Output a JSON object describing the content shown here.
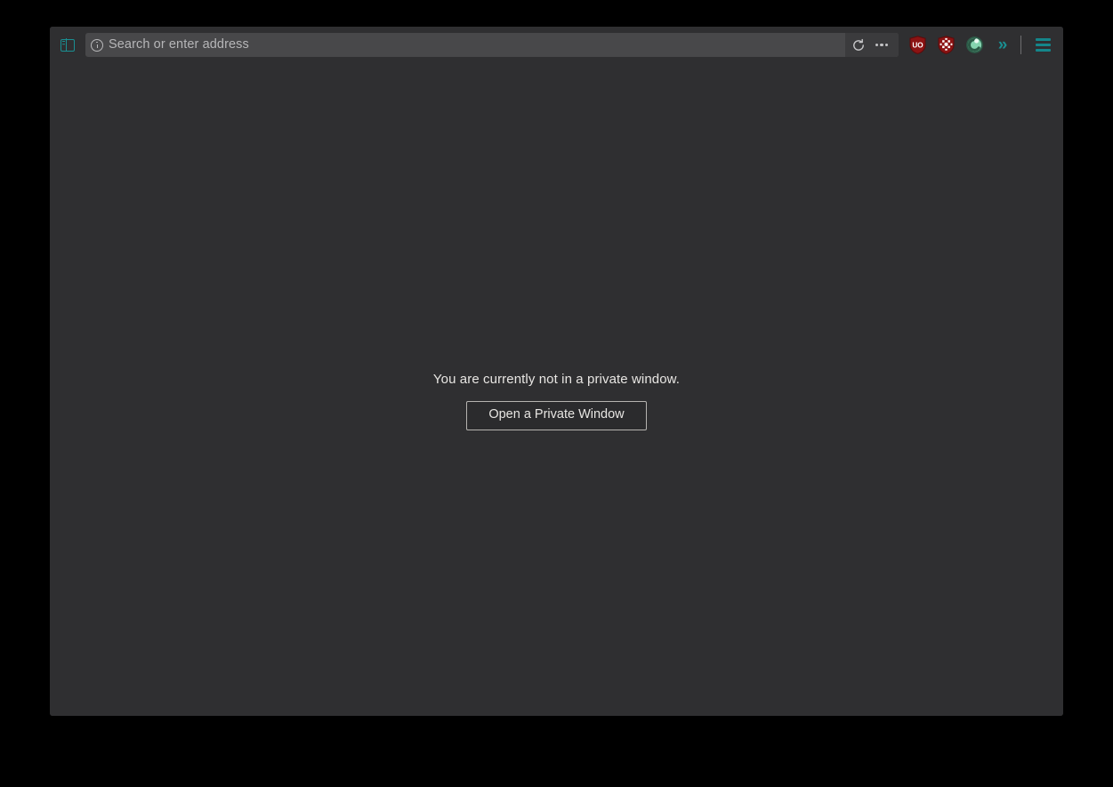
{
  "window": {
    "chrome_color": "#2f2f31",
    "accent_color": "#1a8f92"
  },
  "toolbar": {
    "sidebar_toggle": {
      "icon": "sidebar-panel-icon",
      "tooltip": "Sidebars"
    },
    "address_bar": {
      "identity_icon": "info-circle-icon",
      "value": "",
      "placeholder": "Search or enter address",
      "reload": {
        "icon": "reload-icon",
        "label": "↻"
      },
      "page_actions": {
        "icon": "ellipsis-icon"
      }
    },
    "extensions": [
      {
        "name": "ublock-origin-icon",
        "label": "UO",
        "shield_color": "#8f1515",
        "shield_dark": "#6d0f0f",
        "text_color": "#ffffff"
      },
      {
        "name": "noscript-icon",
        "label": "",
        "shield_color": "#8f1515",
        "shield_dark": "#6d0f0f",
        "text_color": "#ffffff"
      },
      {
        "name": "privacy-extension-icon",
        "label": "",
        "shield_color": "#7ecfab",
        "shield_dark": "#2c5f4a",
        "text_color": "#ffffff"
      }
    ],
    "overflow_chevron": {
      "name": "chevron-double-right-icon",
      "glyph": "»"
    },
    "app_menu": {
      "name": "hamburger-menu-icon",
      "color": "#14868a"
    }
  },
  "content": {
    "message": "You are currently not in a private window.",
    "button_label": "Open a Private Window"
  }
}
